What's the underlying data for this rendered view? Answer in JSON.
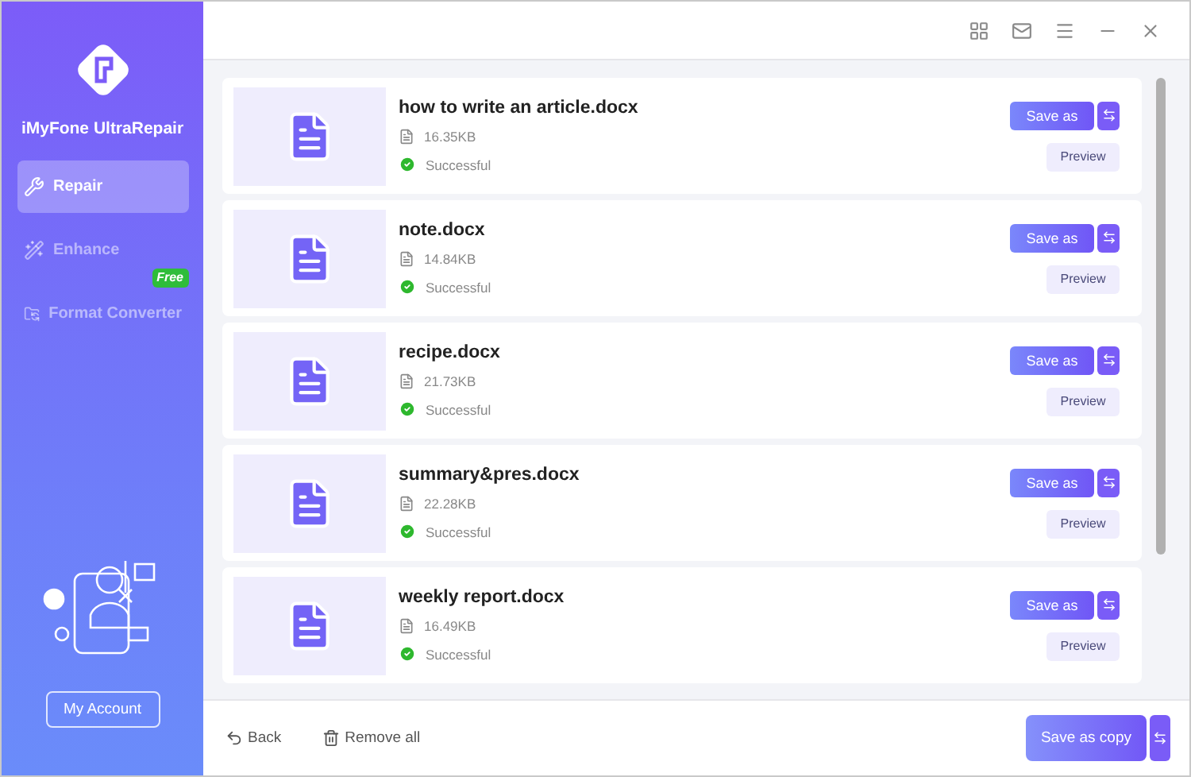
{
  "sidebar": {
    "app_name": "iMyFone UltraRepair",
    "items": [
      {
        "label": "Repair",
        "kind": "repair",
        "selected": true
      },
      {
        "label": "Enhance",
        "kind": "enhance",
        "selected": false
      },
      {
        "label": "Format Converter",
        "kind": "convert",
        "selected": false,
        "badge": "Free"
      }
    ],
    "account_button": "My Account"
  },
  "files": [
    {
      "name": "how to write an article.docx",
      "size": "16.35KB",
      "status": "Successful",
      "save_button": "Save as",
      "preview_button": "Preview"
    },
    {
      "name": "note.docx",
      "size": "14.84KB",
      "status": "Successful",
      "save_button": "Save as",
      "preview_button": "Preview"
    },
    {
      "name": "recipe.docx",
      "size": "21.73KB",
      "status": "Successful",
      "save_button": "Save as",
      "preview_button": "Preview"
    },
    {
      "name": "summary&pres.docx",
      "size": "22.28KB",
      "status": "Successful",
      "save_button": "Save as",
      "preview_button": "Preview"
    },
    {
      "name": "weekly report.docx",
      "size": "16.49KB",
      "status": "Successful",
      "save_button": "Save as",
      "preview_button": "Preview"
    }
  ],
  "footer": {
    "back": "Back",
    "remove_all": "Remove all",
    "save_copy": "Save as copy"
  }
}
